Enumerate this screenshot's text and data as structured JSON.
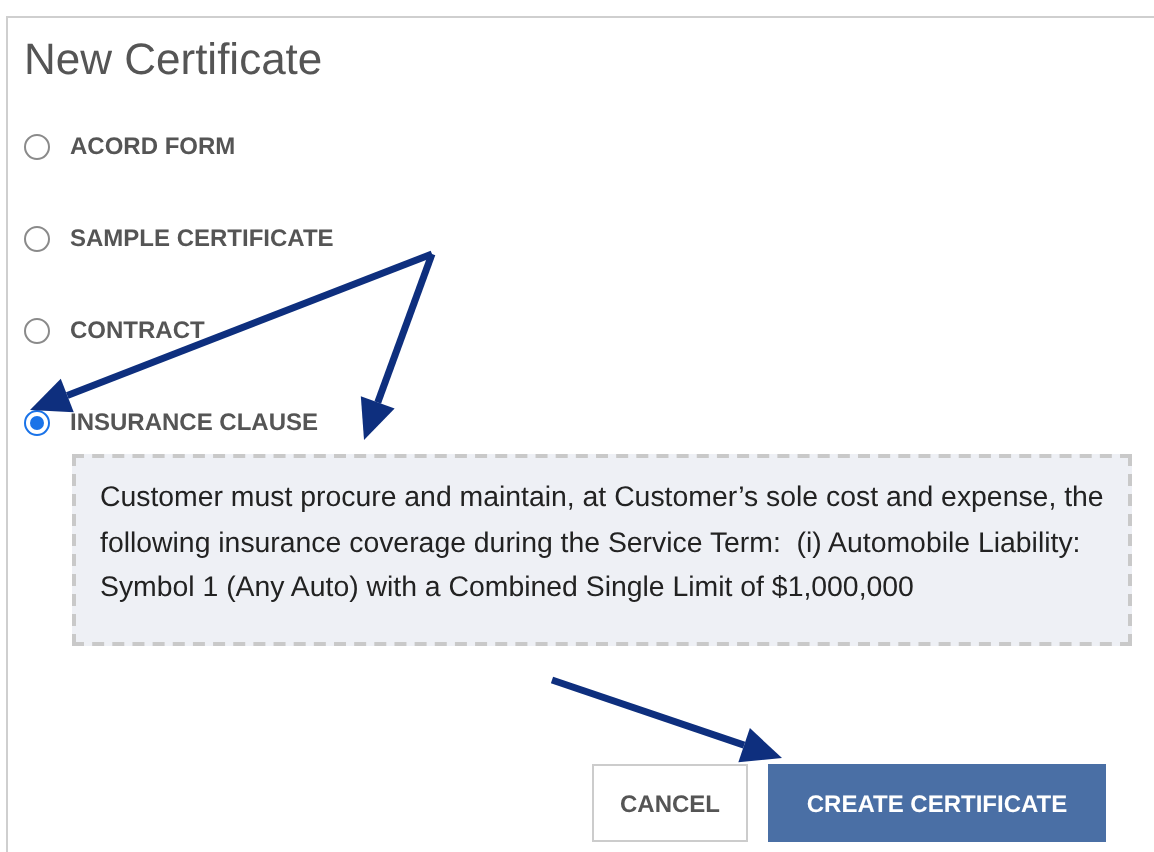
{
  "dialog": {
    "title": "New Certificate",
    "options": [
      {
        "label": "ACORD FORM",
        "selected": false
      },
      {
        "label": "SAMPLE CERTIFICATE",
        "selected": false
      },
      {
        "label": "CONTRACT",
        "selected": false
      },
      {
        "label": "INSURANCE CLAUSE",
        "selected": true
      }
    ],
    "clause_text": "Customer must procure and maintain, at Customer’s sole cost and expense, the following insurance coverage during the Service Term:  (i) Automobile Liability: Symbol 1 (Any Auto) with a Combined Single Limit of $1,000,000",
    "buttons": [
      {
        "label": "CANCEL",
        "kind": "secondary"
      },
      {
        "label": "CREATE CERTIFICATE",
        "kind": "primary"
      }
    ]
  }
}
